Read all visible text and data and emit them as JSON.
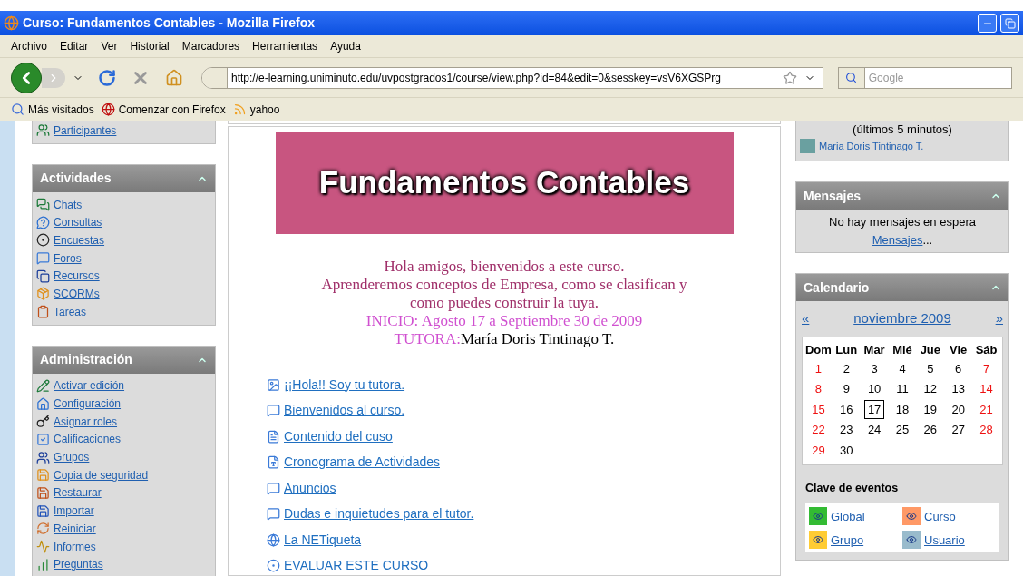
{
  "window": {
    "title": "Curso: Fundamentos Contables - Mozilla Firefox"
  },
  "menu": [
    "Archivo",
    "Editar",
    "Ver",
    "Historial",
    "Marcadores",
    "Herramientas",
    "Ayuda"
  ],
  "address": {
    "url": "http://e-learning.uniminuto.edu/uvpostgrados1/course/view.php?id=84&edit=0&sesskey=vsV6XGSPrg"
  },
  "search": {
    "placeholder": "Google"
  },
  "bookmarks": [
    "Más visitados",
    "Comenzar con Firefox",
    "yahoo"
  ],
  "left": {
    "top_link": "Participantes",
    "blocks": [
      {
        "title": "Actividades",
        "items": [
          "Chats",
          "Consultas",
          "Encuestas",
          "Foros",
          "Recursos",
          "SCORMs",
          "Tareas"
        ]
      },
      {
        "title": "Administración",
        "items": [
          "Activar edición",
          "Configuración",
          "Asignar roles",
          "Calificaciones",
          "Grupos",
          "Copia de seguridad",
          "Restaurar",
          "Importar",
          "Reiniciar",
          "Informes",
          "Preguntas"
        ]
      }
    ]
  },
  "center": {
    "banner_title": "Fundamentos Contables",
    "intro": [
      "Hola amigos, bienvenidos a este curso.",
      "Aprenderemos conceptos de Empresa, como se clasifican y",
      "como puedes construir la tuya."
    ],
    "dates": "INICIO: Agosto 17 a Septiembre 30 de 2009",
    "tutor_label": "TUTORA:",
    "tutor_name": "María Doris Tintinago T.",
    "resources": [
      "¡¡Hola!! Soy tu tutora.",
      "Bienvenidos al curso.",
      "Contenido del cuso",
      "Cronograma de Actividades",
      "Anuncios",
      "Dudas e inquietudes para el tutor.",
      "La NETiqueta",
      "EVALUAR ESTE CURSO"
    ]
  },
  "right": {
    "online_note": "(últimos 5 minutos)",
    "online_user": "Maria Doris Tintinago T.",
    "messages": {
      "title": "Mensajes",
      "text": "No hay mensajes en espera",
      "link": "Mensajes",
      "suffix": "..."
    },
    "calendar": {
      "title": "Calendario",
      "prev": "«",
      "month": "noviembre 2009",
      "next": "»",
      "weekdays": [
        "Dom",
        "Lun",
        "Mar",
        "Mié",
        "Jue",
        "Vie",
        "Sáb"
      ],
      "weeks": [
        [
          {
            "day": "1",
            "weekend": true,
            "today": false
          },
          {
            "day": "2",
            "weekend": false,
            "today": false
          },
          {
            "day": "3",
            "weekend": false,
            "today": false
          },
          {
            "day": "4",
            "weekend": false,
            "today": false
          },
          {
            "day": "5",
            "weekend": false,
            "today": false
          },
          {
            "day": "6",
            "weekend": false,
            "today": false
          },
          {
            "day": "7",
            "weekend": true,
            "today": false
          }
        ],
        [
          {
            "day": "8",
            "weekend": true,
            "today": false
          },
          {
            "day": "9",
            "weekend": false,
            "today": false
          },
          {
            "day": "10",
            "weekend": false,
            "today": false
          },
          {
            "day": "11",
            "weekend": false,
            "today": false
          },
          {
            "day": "12",
            "weekend": false,
            "today": false
          },
          {
            "day": "13",
            "weekend": false,
            "today": false
          },
          {
            "day": "14",
            "weekend": true,
            "today": false
          }
        ],
        [
          {
            "day": "15",
            "weekend": true,
            "today": false
          },
          {
            "day": "16",
            "weekend": false,
            "today": false
          },
          {
            "day": "17",
            "weekend": false,
            "today": true
          },
          {
            "day": "18",
            "weekend": false,
            "today": false
          },
          {
            "day": "19",
            "weekend": false,
            "today": false
          },
          {
            "day": "20",
            "weekend": false,
            "today": false
          },
          {
            "day": "21",
            "weekend": true,
            "today": false
          }
        ],
        [
          {
            "day": "22",
            "weekend": true,
            "today": false
          },
          {
            "day": "23",
            "weekend": false,
            "today": false
          },
          {
            "day": "24",
            "weekend": false,
            "today": false
          },
          {
            "day": "25",
            "weekend": false,
            "today": false
          },
          {
            "day": "26",
            "weekend": false,
            "today": false
          },
          {
            "day": "27",
            "weekend": false,
            "today": false
          },
          {
            "day": "28",
            "weekend": true,
            "today": false
          }
        ],
        [
          {
            "day": "29",
            "weekend": true,
            "today": false
          },
          {
            "day": "30",
            "weekend": false,
            "today": false
          }
        ]
      ],
      "legend_title": "Clave de eventos",
      "legend": [
        {
          "label": "Global",
          "color": "#33bb33"
        },
        {
          "label": "Curso",
          "color": "#ff9966"
        },
        {
          "label": "Grupo",
          "color": "#ffcc33"
        },
        {
          "label": "Usuario",
          "color": "#99bbcc"
        }
      ]
    }
  }
}
